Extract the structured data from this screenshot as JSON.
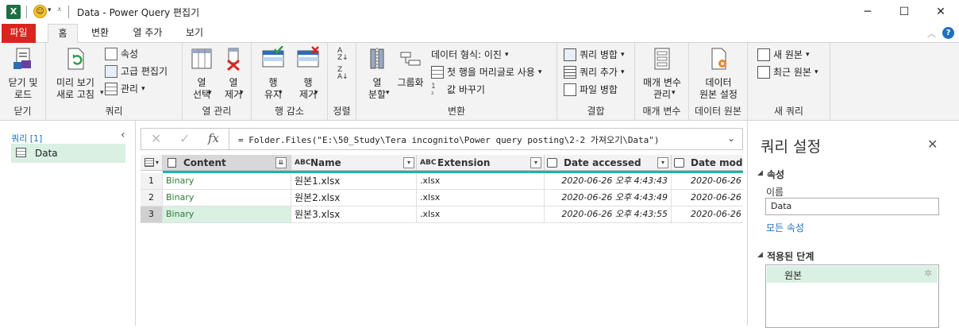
{
  "window": {
    "title": "Data - Power Query 편집기",
    "controls": [
      "minimize",
      "maximize",
      "close"
    ]
  },
  "tabs": [
    {
      "label": "파일"
    },
    {
      "label": "홈"
    },
    {
      "label": "변환"
    },
    {
      "label": "열 추가"
    },
    {
      "label": "보기"
    }
  ],
  "ribbon": {
    "close_group": {
      "button": "닫기 및\n로드",
      "label": "닫기"
    },
    "query_group": {
      "refresh": "미리 보기\n새로 고침",
      "properties": "속성",
      "advanced_editor": "고급 편집기",
      "manage": "관리",
      "label": "쿼리"
    },
    "columns_group": {
      "choose": "열\n선택",
      "remove": "열\n제거",
      "label": "열 관리"
    },
    "rows_group": {
      "keep": "행\n유지",
      "remove": "행\n제거",
      "label": "행 감소"
    },
    "sort_group": {
      "label": "정렬"
    },
    "transform_group": {
      "split": "열\n분할",
      "group_by": "그룹화",
      "data_type": "데이터 형식: 이진",
      "use_first_row": "첫 행을 머리글로 사용",
      "replace_values": "값 바꾸기",
      "label": "변환"
    },
    "combine_group": {
      "merge": "쿼리 병합",
      "append": "쿼리 추가",
      "combine_files": "파일 병합",
      "label": "결합"
    },
    "params_group": {
      "manage": "매개 변수\n관리",
      "label": "매개 변수"
    },
    "datasource_group": {
      "settings": "데이터\n원본 설정",
      "label": "데이터 원본"
    },
    "newquery_group": {
      "new_source": "새 원본",
      "recent_sources": "최근 원본",
      "label": "새 쿼리"
    }
  },
  "left_pane": {
    "header": "쿼리 [1]",
    "queries": [
      {
        "label": "Data"
      }
    ]
  },
  "formula_bar": {
    "fx": "fx",
    "text": "= Folder.Files(\"E:\\50_Study\\Tera incognito\\Power query posting\\2-2 가져오기\\Data\")"
  },
  "table": {
    "columns": [
      {
        "name": "Content",
        "type": "binary"
      },
      {
        "name": "Name",
        "type": "ABC"
      },
      {
        "name": "Extension",
        "type": "ABC"
      },
      {
        "name": "Date accessed",
        "type": "datetime"
      },
      {
        "name": "Date modifie",
        "type": "datetime"
      }
    ],
    "rows": [
      {
        "num": "1",
        "content": "Binary",
        "name": "원본1.xlsx",
        "ext": ".xlsx",
        "accessed": "2020-06-26 오후 4:43:43",
        "modified": "2020-06-26"
      },
      {
        "num": "2",
        "content": "Binary",
        "name": "원본2.xlsx",
        "ext": ".xlsx",
        "accessed": "2020-06-26 오후 4:43:49",
        "modified": "2020-06-26"
      },
      {
        "num": "3",
        "content": "Binary",
        "name": "원본3.xlsx",
        "ext": ".xlsx",
        "accessed": "2020-06-26 오후 4:43:55",
        "modified": "2020-06-26"
      }
    ]
  },
  "right_pane": {
    "title": "쿼리 설정",
    "properties_header": "속성",
    "name_label": "이름",
    "name_value": "Data",
    "all_properties": "모든 속성",
    "steps_header": "적용된 단계",
    "steps": [
      {
        "label": "원본"
      }
    ]
  },
  "colors": {
    "file_tab": "#d9251d",
    "accent_teal": "#1eb5a6",
    "binary_green": "#2e7d32",
    "selected_row": "#d9f0e3"
  }
}
